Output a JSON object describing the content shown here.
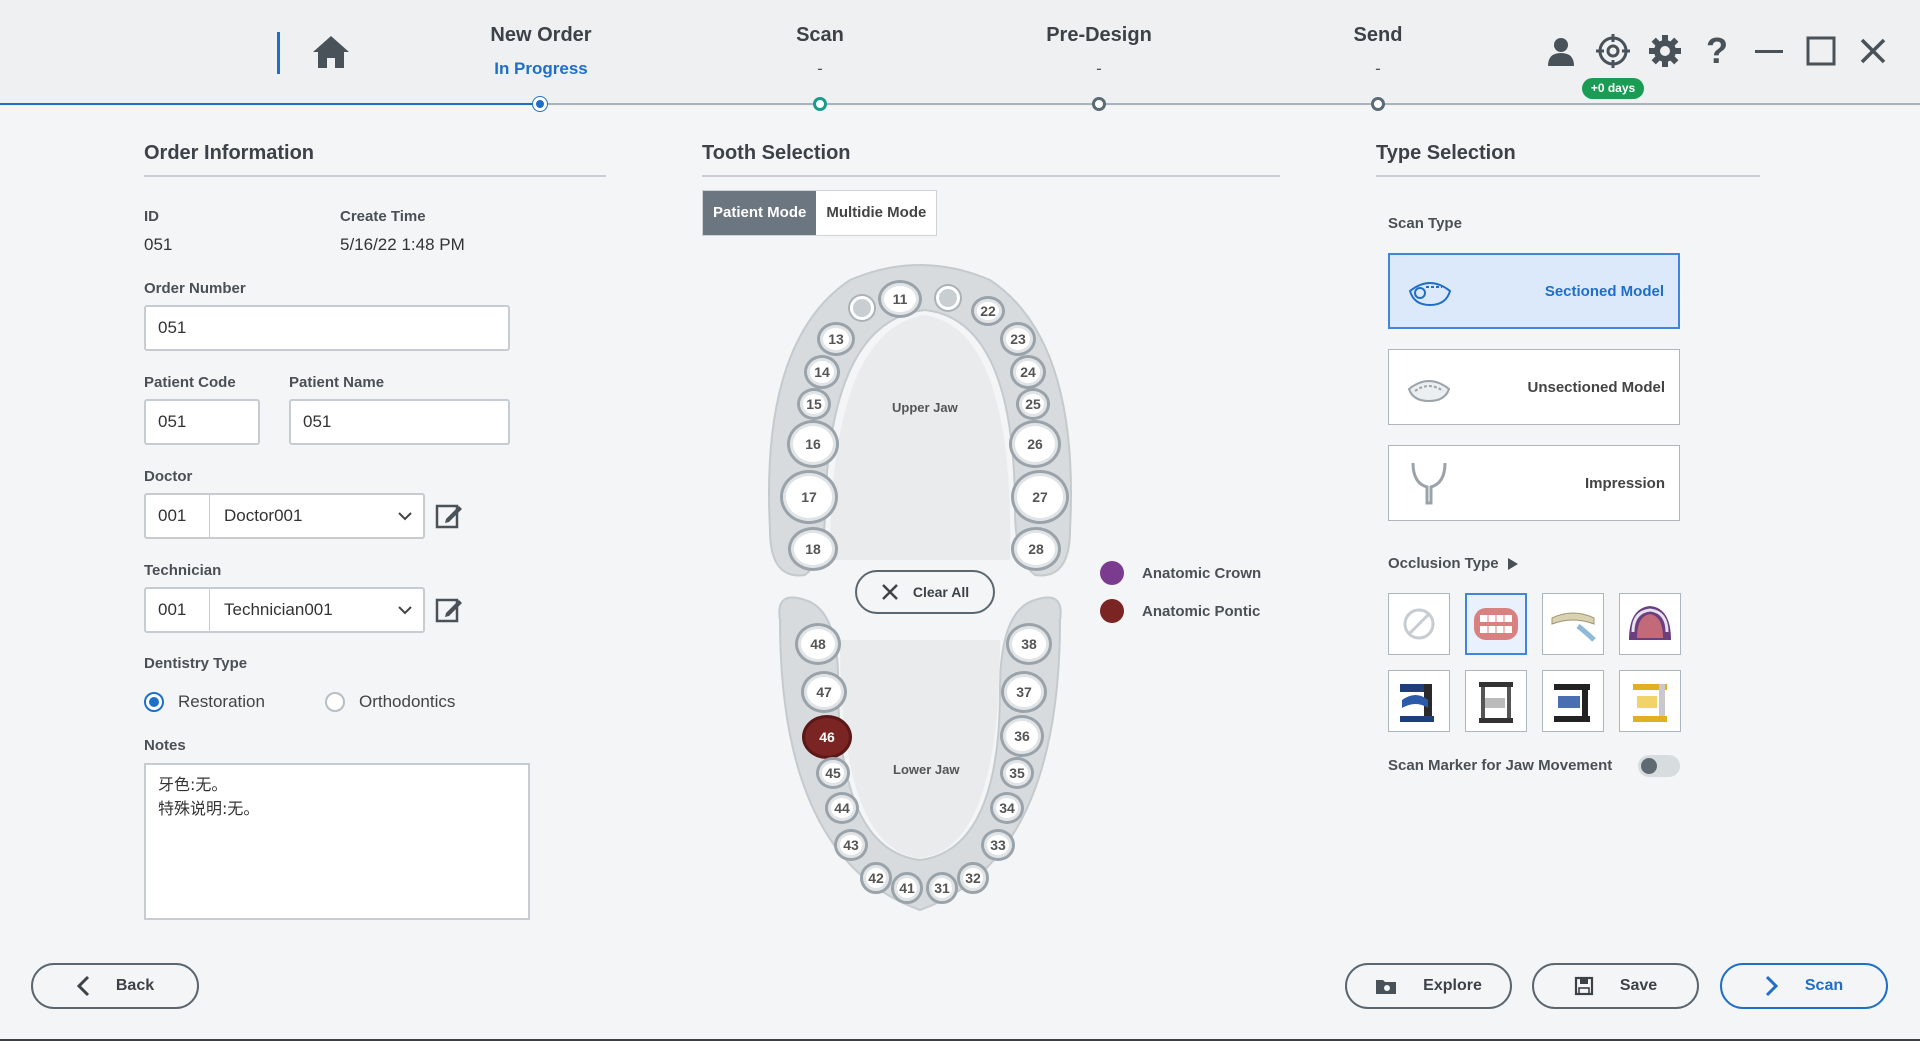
{
  "header": {
    "steps": [
      {
        "title": "New Order",
        "status": "In Progress"
      },
      {
        "title": "Scan",
        "status": "-"
      },
      {
        "title": "Pre-Design",
        "status": "-"
      },
      {
        "title": "Send",
        "status": "-"
      }
    ],
    "days_badge": "+0 days",
    "icons": [
      "home-icon",
      "user-icon",
      "crosshair-icon",
      "gear-icon",
      "help-icon",
      "minimize-icon",
      "maximize-icon",
      "close-icon"
    ]
  },
  "order_info": {
    "title": "Order Information",
    "id_label": "ID",
    "id_value": "051",
    "create_time_label": "Create Time",
    "create_time_value": "5/16/22 1:48 PM",
    "order_number_label": "Order Number",
    "order_number_value": "051",
    "patient_code_label": "Patient Code",
    "patient_code_value": "051",
    "patient_name_label": "Patient Name",
    "patient_name_value": "051",
    "doctor_label": "Doctor",
    "doctor_code": "001",
    "doctor_name": "Doctor001",
    "technician_label": "Technician",
    "technician_code": "001",
    "technician_name": "Technician001",
    "dentistry_type_label": "Dentistry Type",
    "dentistry_options": [
      "Restoration",
      "Orthodontics"
    ],
    "dentistry_selected": "Restoration",
    "notes_label": "Notes",
    "notes_line1": "牙色:无。",
    "notes_line2": "特殊说明:无。"
  },
  "tooth_selection": {
    "title": "Tooth Selection",
    "modes": [
      "Patient Mode",
      "Multidie Mode"
    ],
    "active_mode": "Patient Mode",
    "upper_jaw_label": "Upper Jaw",
    "lower_jaw_label": "Lower Jaw",
    "clear_all_label": "Clear All",
    "upper_teeth": [
      "11",
      "22",
      "13",
      "23",
      "14",
      "24",
      "15",
      "25",
      "16",
      "26",
      "17",
      "27",
      "18",
      "28"
    ],
    "lower_teeth": [
      "48",
      "38",
      "47",
      "37",
      "46",
      "36",
      "45",
      "35",
      "44",
      "34",
      "43",
      "33",
      "42",
      "32",
      "41",
      "31"
    ],
    "selected_pontic": "46",
    "legend": [
      {
        "label": "Anatomic Crown",
        "color": "#7b3b8f"
      },
      {
        "label": "Anatomic Pontic",
        "color": "#7a2424"
      }
    ]
  },
  "type_selection": {
    "title": "Type Selection",
    "scan_type_label": "Scan Type",
    "scan_types": [
      "Sectioned Model",
      "Unsectioned Model",
      "Impression"
    ],
    "selected_scan_type": "Sectioned Model",
    "occlusion_type_label": "Occlusion Type",
    "occlusion_selected_index": 1,
    "jaw_marker_label": "Scan Marker for Jaw Movement",
    "jaw_marker_enabled": false
  },
  "footer": {
    "back_label": "Back",
    "explore_label": "Explore",
    "save_label": "Save",
    "scan_label": "Scan"
  },
  "colors": {
    "accent": "#1f6fc8",
    "badge": "#1a9c55",
    "pontic": "#7a2424",
    "crown": "#7b3b8f"
  }
}
